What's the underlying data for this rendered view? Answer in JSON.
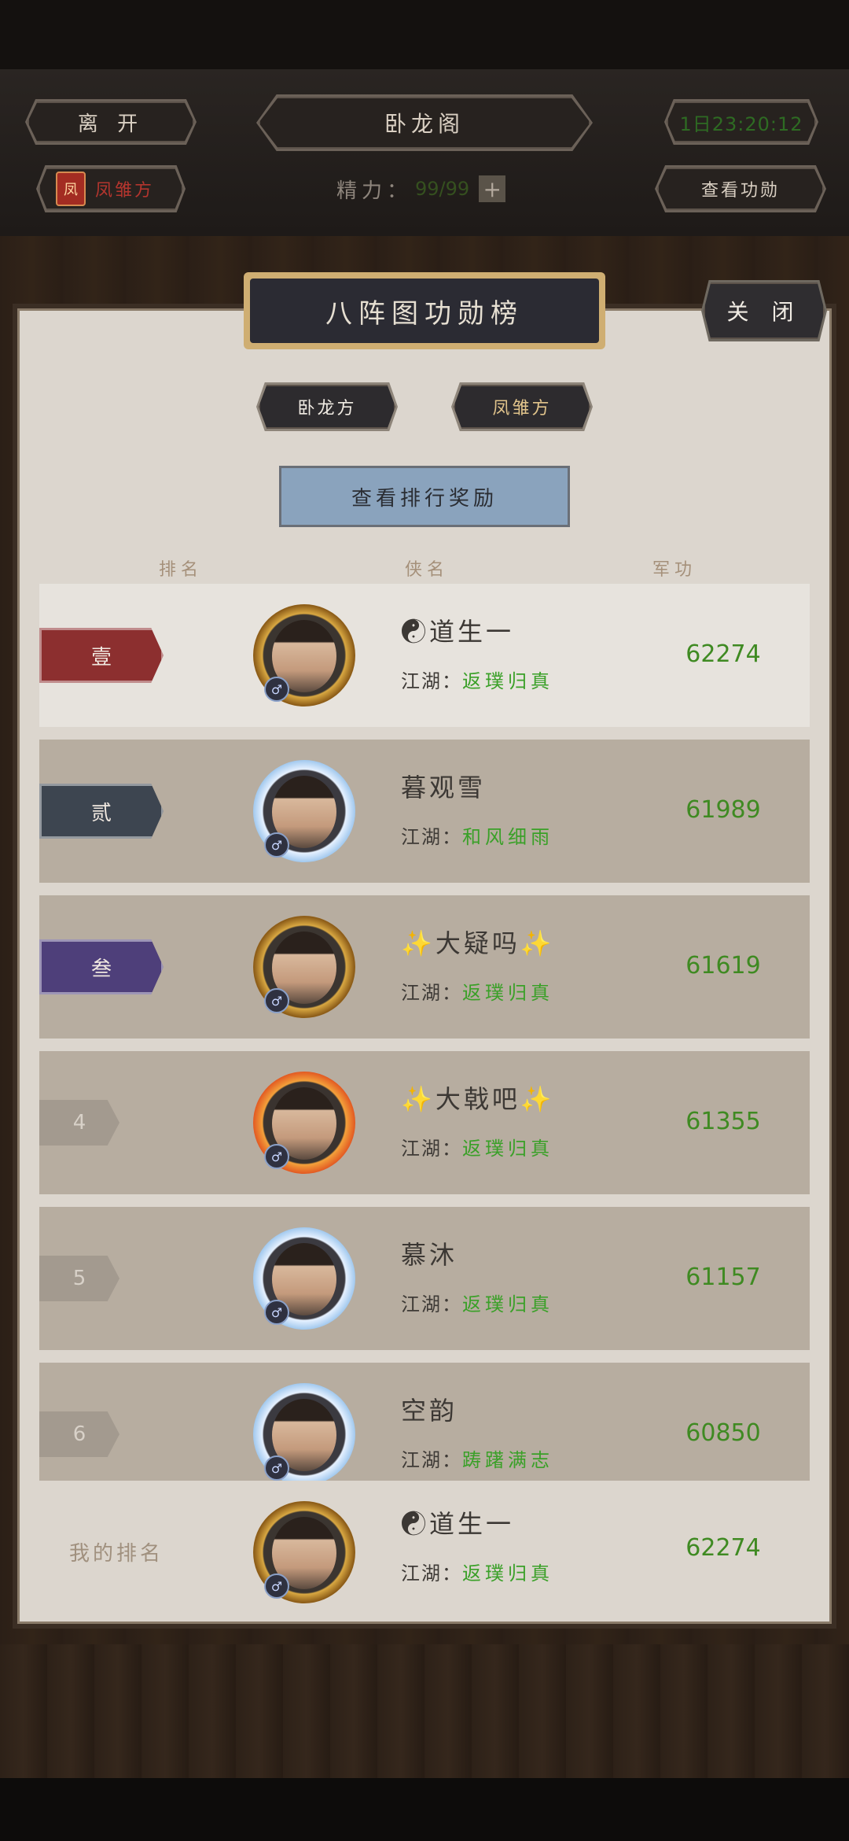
{
  "header": {
    "leave_label": "离 开",
    "title": "卧龙阁",
    "timer": "1日23:20:12",
    "faction_label": "凤雏方",
    "faction_icon": "凤",
    "energy_label": "精力：",
    "energy_value": "99/99",
    "energy_plus": "+",
    "view_merit_label": "查看功勋"
  },
  "panel": {
    "title": "八阵图功勋榜",
    "close_label": "关 闭",
    "tabs": [
      {
        "label": "卧龙方"
      },
      {
        "label": "凤雏方"
      }
    ],
    "reward_button": "查看排行奖励",
    "columns": {
      "rank": "排名",
      "name": "侠名",
      "merit": "军功"
    }
  },
  "ranking": [
    {
      "rank": "壹",
      "name": "☯道生一",
      "jianghu_label": "江湖：",
      "jianghu": "返璞归真",
      "score": "62274",
      "badge_color": "#8c2f2f",
      "frame": "gold"
    },
    {
      "rank": "贰",
      "name": "暮观雪",
      "jianghu_label": "江湖：",
      "jianghu": "和风细雨",
      "score": "61989",
      "badge_color": "#3d4550",
      "frame": "ice"
    },
    {
      "rank": "叁",
      "name": "✨大疑吗✨",
      "jianghu_label": "江湖：",
      "jianghu": "返璞归真",
      "score": "61619",
      "badge_color": "#4e3f7a",
      "frame": "gold"
    },
    {
      "rank": "4",
      "name": "✨大戟吧✨",
      "jianghu_label": "江湖：",
      "jianghu": "返璞归真",
      "score": "61355",
      "frame": "fire"
    },
    {
      "rank": "5",
      "name": "慕沐",
      "jianghu_label": "江湖：",
      "jianghu": "返璞归真",
      "score": "61157",
      "frame": "ice"
    },
    {
      "rank": "6",
      "name": "空韵",
      "jianghu_label": "江湖：",
      "jianghu": "踌躇满志",
      "score": "60850",
      "frame": "ice"
    }
  ],
  "my_rank": {
    "label": "我的排名",
    "name": "☯道生一",
    "jianghu_label": "江湖：",
    "jianghu": "返璞归真",
    "score": "62274"
  },
  "gender_symbol": "♂"
}
